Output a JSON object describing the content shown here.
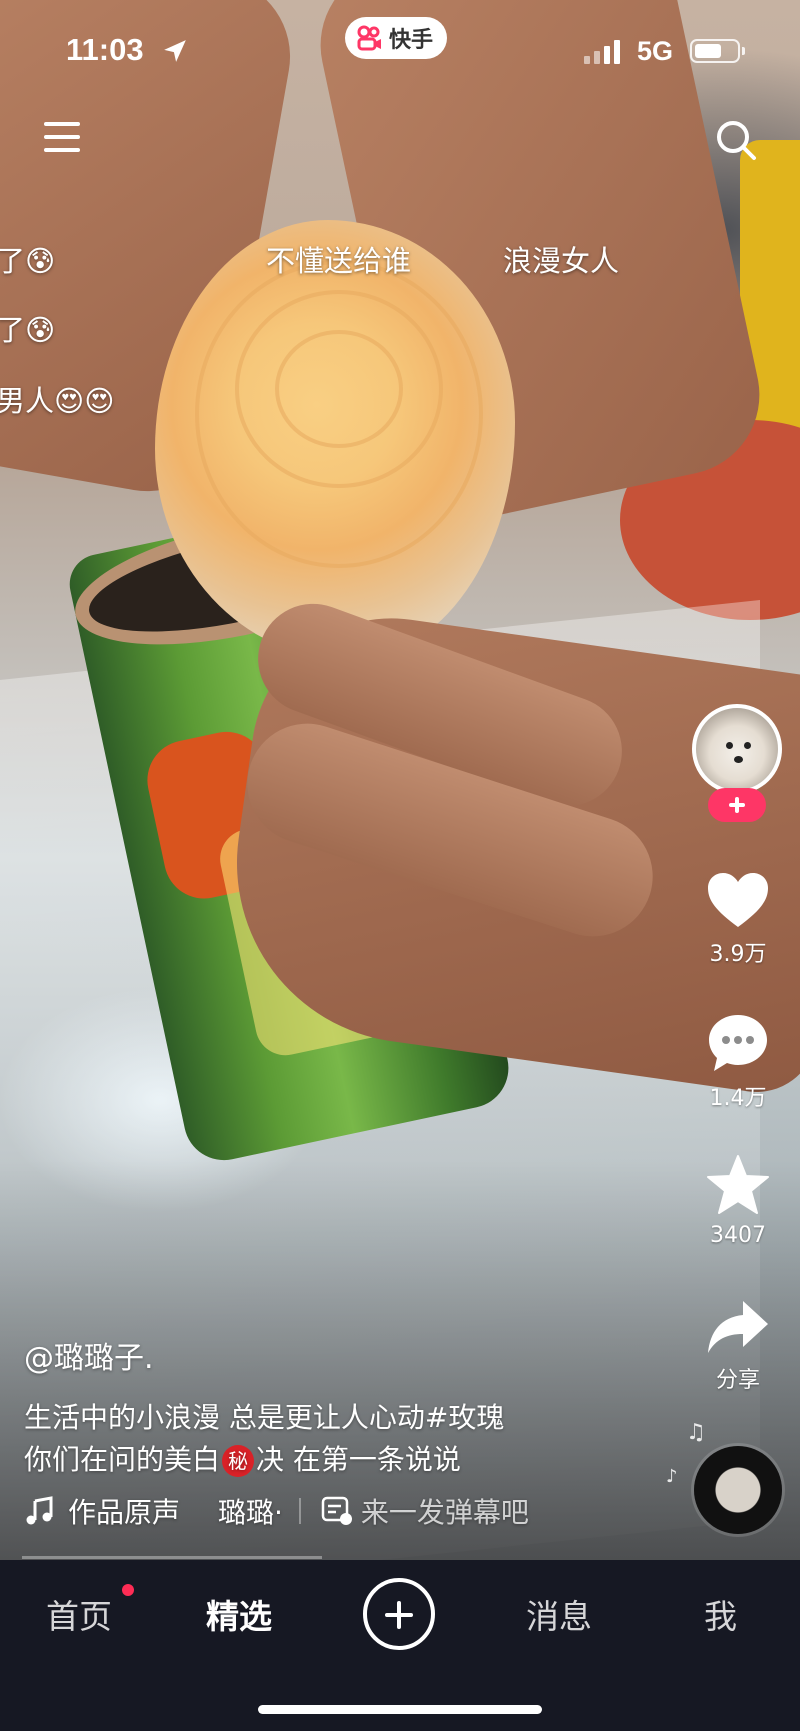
{
  "status_bar": {
    "time": "11:03",
    "network": "5G",
    "app_brand": "快手"
  },
  "danmaku": [
    {
      "text": "了😰"
    },
    {
      "text": "不懂送给谁"
    },
    {
      "text": "浪漫女人"
    },
    {
      "text": "了😰"
    },
    {
      "text": "男人😍😍"
    }
  ],
  "actions": {
    "like_count": "3.9万",
    "comment_count": "1.4万",
    "favorite_count": "3407",
    "share_label": "分享"
  },
  "post": {
    "author": "@璐璐子.",
    "desc_line1": "生活中的小浪漫 总是更让人心动#玫瑰",
    "desc_line2_a": "你们在问的美白",
    "desc_secret": "秘",
    "desc_line2_b": "决 在第一条说说",
    "music_label": "作品原声",
    "music_author": "璐璐·",
    "danmaku_placeholder": "来一发弹幕吧"
  },
  "tabs": {
    "home": "首页",
    "featured": "精选",
    "messages": "消息",
    "me": "我"
  },
  "colors": {
    "accent": "#fe2c55",
    "tabbar_bg": "#161823"
  }
}
